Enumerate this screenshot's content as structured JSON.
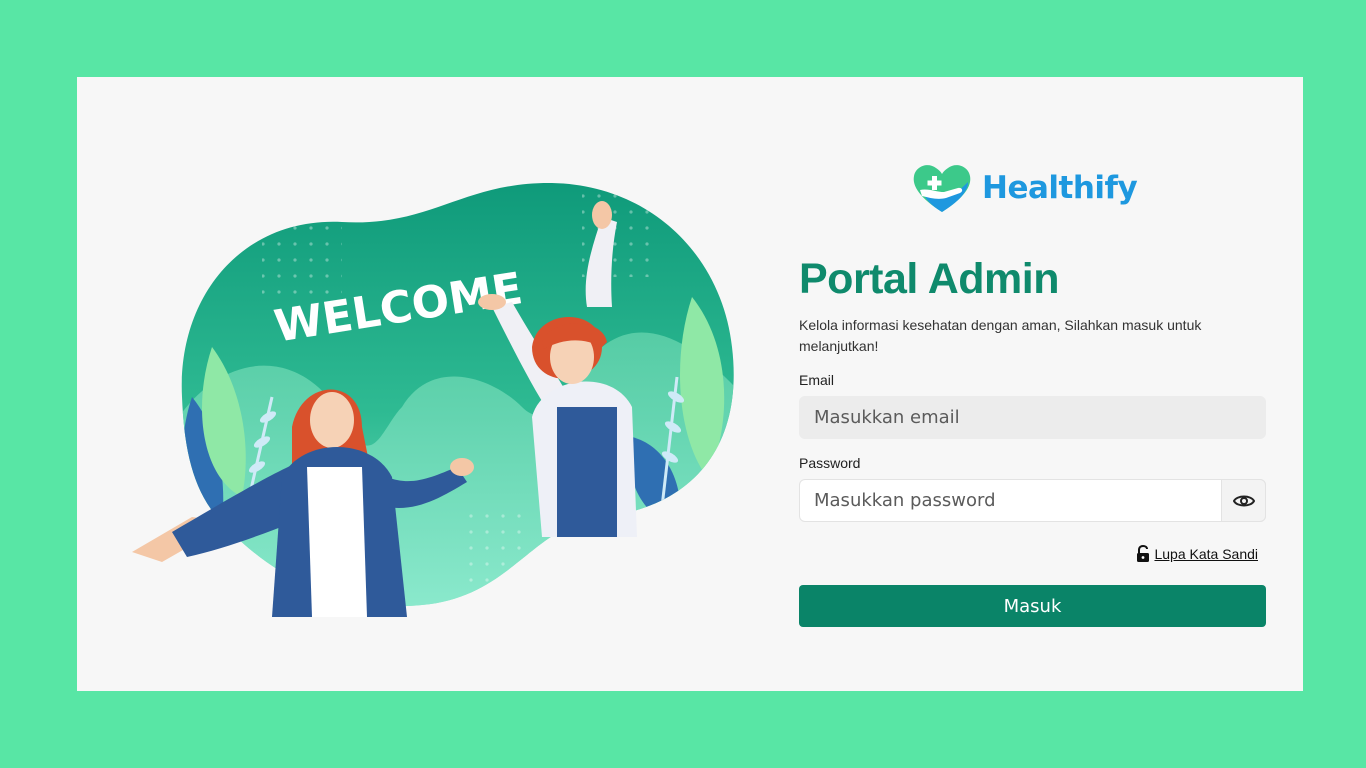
{
  "illustration": {
    "headline": "WELCOME"
  },
  "brand": {
    "name": "Healthify",
    "logo_icon": "heart-hand-cross-icon",
    "color": "#1e98df"
  },
  "login": {
    "title": "Portal Admin",
    "subtitle": "Kelola informasi kesehatan dengan aman, Silahkan masuk untuk melanjutkan!",
    "email_label": "Email",
    "email_placeholder": "Masukkan email",
    "password_label": "Password",
    "password_placeholder": "Masukkan password",
    "show_password_icon": "eye-icon",
    "forgot_icon": "unlock-icon",
    "forgot_label": "Lupa Kata Sandi",
    "submit_label": "Masuk"
  },
  "colors": {
    "background": "#58e6a5",
    "card": "#f7f7f7",
    "title": "#0f8a6c",
    "button": "#0a8468"
  }
}
